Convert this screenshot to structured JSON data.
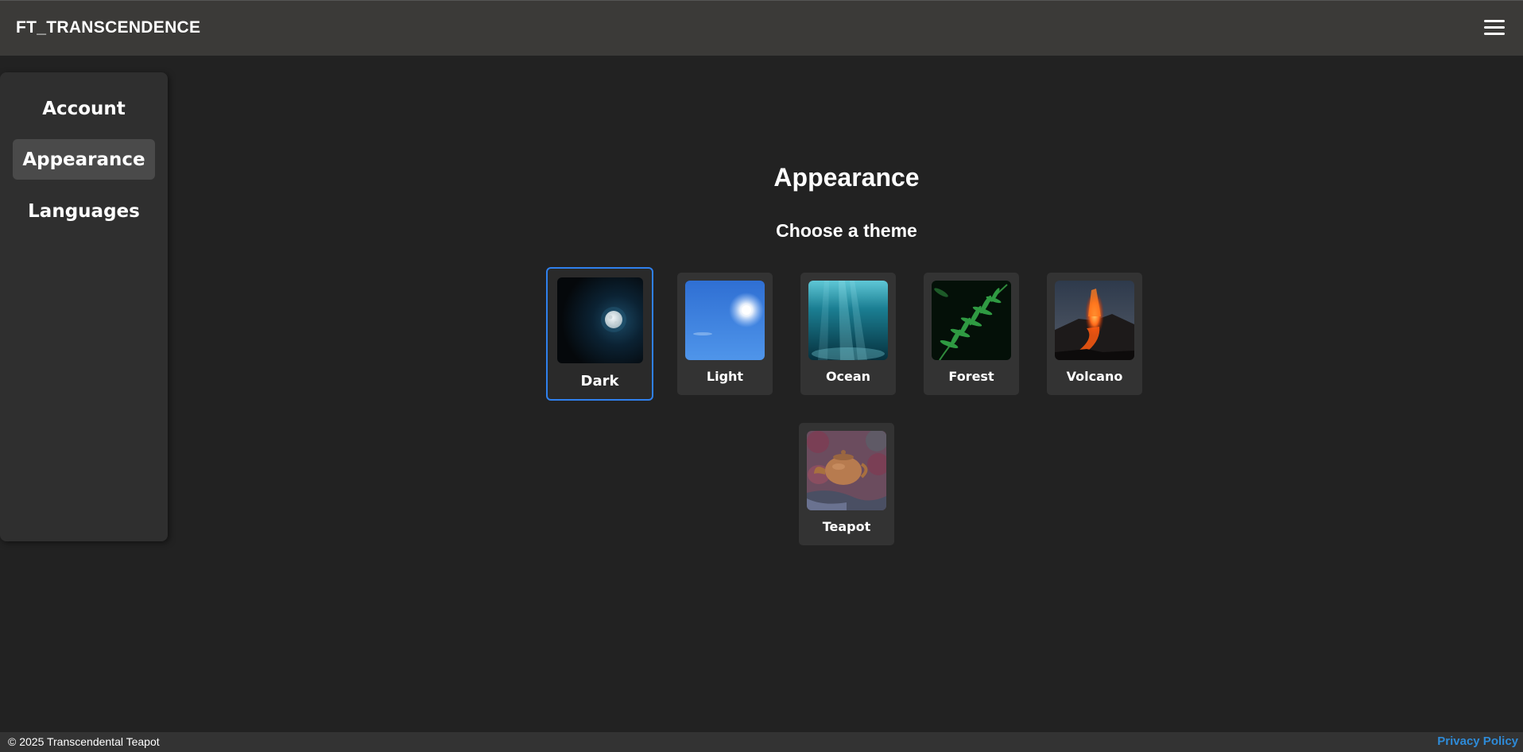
{
  "header": {
    "brand": "FT_TRANSCENDENCE",
    "menu_icon": "hamburger-menu-icon"
  },
  "sidebar": {
    "items": [
      {
        "label": "Account"
      },
      {
        "label": "Appearance",
        "active": true
      },
      {
        "label": "Languages"
      }
    ]
  },
  "main": {
    "title": "Appearance",
    "subtitle": "Choose a theme",
    "themes": [
      {
        "label": "Dark",
        "selected": true
      },
      {
        "label": "Light"
      },
      {
        "label": "Ocean"
      },
      {
        "label": "Forest"
      },
      {
        "label": "Volcano"
      },
      {
        "label": "Teapot"
      }
    ]
  },
  "footer": {
    "copyright": "© 2025 Transcendental Teapot",
    "privacy": "Privacy Policy"
  },
  "colors": {
    "accent": "#2f80ed",
    "link": "#2e8bd8",
    "background": "#222222"
  }
}
